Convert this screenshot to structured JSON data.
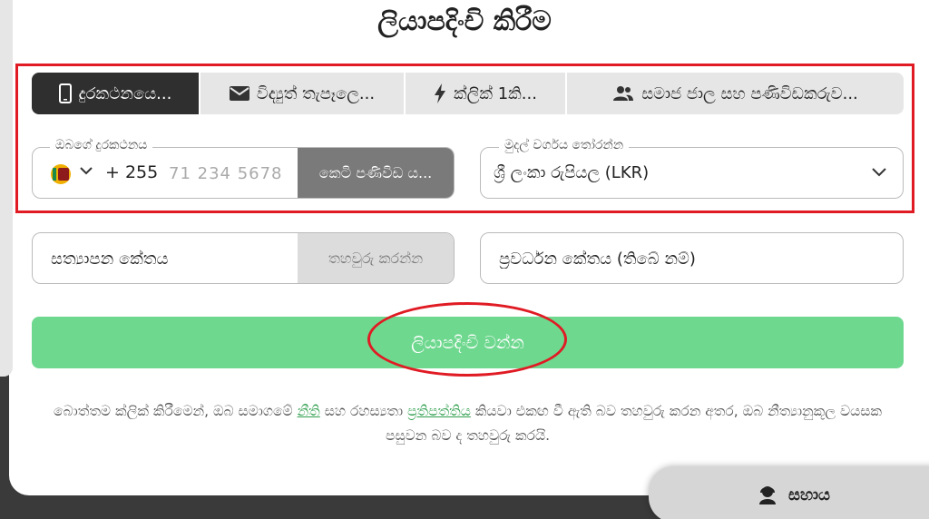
{
  "title": "ලියාපදිංචි කිරීම",
  "tabs": [
    {
      "label": "දුරකථනයෙ...",
      "icon": "phone-icon",
      "active": true
    },
    {
      "label": "විද්‍යුත් තැපෑලෙ...",
      "icon": "envelope-icon",
      "active": false
    },
    {
      "label": "ක්ලික් 1කි...",
      "icon": "lightning-icon",
      "active": false
    },
    {
      "label": "සමාජ ජාල සහ පණිවිඩකරුව...",
      "icon": "users-icon",
      "active": false
    }
  ],
  "phone": {
    "legend": "ඔබගේ දුරකථනය",
    "country_code": "+ 255",
    "placeholder": "71 234 5678",
    "send_code_label": "කෙටි පණිවිඩ ය..."
  },
  "currency": {
    "legend": "මුදල් වර්ගය තෝරන්න",
    "value": "ශ්‍රී ලංකා රුපියල (LKR)"
  },
  "verification": {
    "placeholder": "සත්‍යාපන කේතය",
    "confirm_label": "තහවුරු කරන්න"
  },
  "promo": {
    "placeholder": "ප්‍රවර්ධන කේතය (තිබේ නම්)"
  },
  "register_label": "ලියාපදිංචි වන්න",
  "terms": {
    "prefix": "බොත්තම ක්ලික් කිරීමෙන්, ඔබ සමාගමේ ",
    "rules_link": "නීති",
    "middle": " සහ රහස්‍යතා ",
    "policy_link": "ප්‍රතිපත්තිය",
    "suffix": " කියවා එකඟ වී ඇති බව තහවුරු කරන අතර, ඔබ නීත්‍යානුකූල වයසක පසුවන බව ද තහවුරු කරයි."
  },
  "help_label": "සහාය",
  "colors": {
    "accent_green": "#6fd88f",
    "link_green": "#2e9e4d",
    "active_tab": "#2f2f2f",
    "highlight_red": "#e01b24"
  }
}
